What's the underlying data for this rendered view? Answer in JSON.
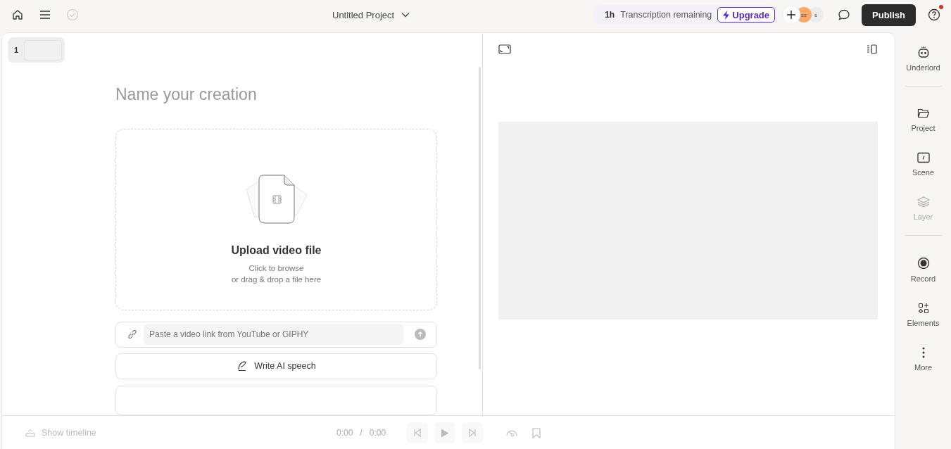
{
  "topbar": {
    "project_title": "Untitled Project",
    "transcription": {
      "amount": "1h",
      "label": "Transcription remaining"
    },
    "upgrade": "Upgrade",
    "avatars": [
      {
        "initials": "ss",
        "color": "#f9a96b"
      },
      {
        "initials": "s",
        "color": "#ececec"
      }
    ],
    "publish": "Publish",
    "help_notification": true
  },
  "scenes": [
    {
      "number": "1",
      "selected": true
    }
  ],
  "editor": {
    "title_placeholder": "Name your creation",
    "upload": {
      "title": "Upload video file",
      "line1": "Click to browse",
      "line2": "or drag & drop a file here"
    },
    "link_placeholder": "Paste a video link from YouTube or GIPHY",
    "write_button": "Write AI speech"
  },
  "sidebar": {
    "items": [
      {
        "kind": "robot",
        "label": "Underlord",
        "disabled": false,
        "divider_after": true
      },
      {
        "kind": "folder",
        "label": "Project",
        "disabled": false,
        "divider_after": false
      },
      {
        "kind": "scene",
        "label": "Scene",
        "disabled": false,
        "divider_after": false
      },
      {
        "kind": "layers",
        "label": "Layer",
        "disabled": true,
        "divider_after": true
      },
      {
        "kind": "record",
        "label": "Record",
        "disabled": false,
        "divider_after": false
      },
      {
        "kind": "elements",
        "label": "Elements",
        "disabled": false,
        "divider_after": false
      },
      {
        "kind": "more",
        "label": "More",
        "disabled": false,
        "divider_after": false
      }
    ]
  },
  "playback": {
    "show_timeline": "Show timeline",
    "current_time": "0:00",
    "separator": "/",
    "total_time": "0:00"
  }
}
